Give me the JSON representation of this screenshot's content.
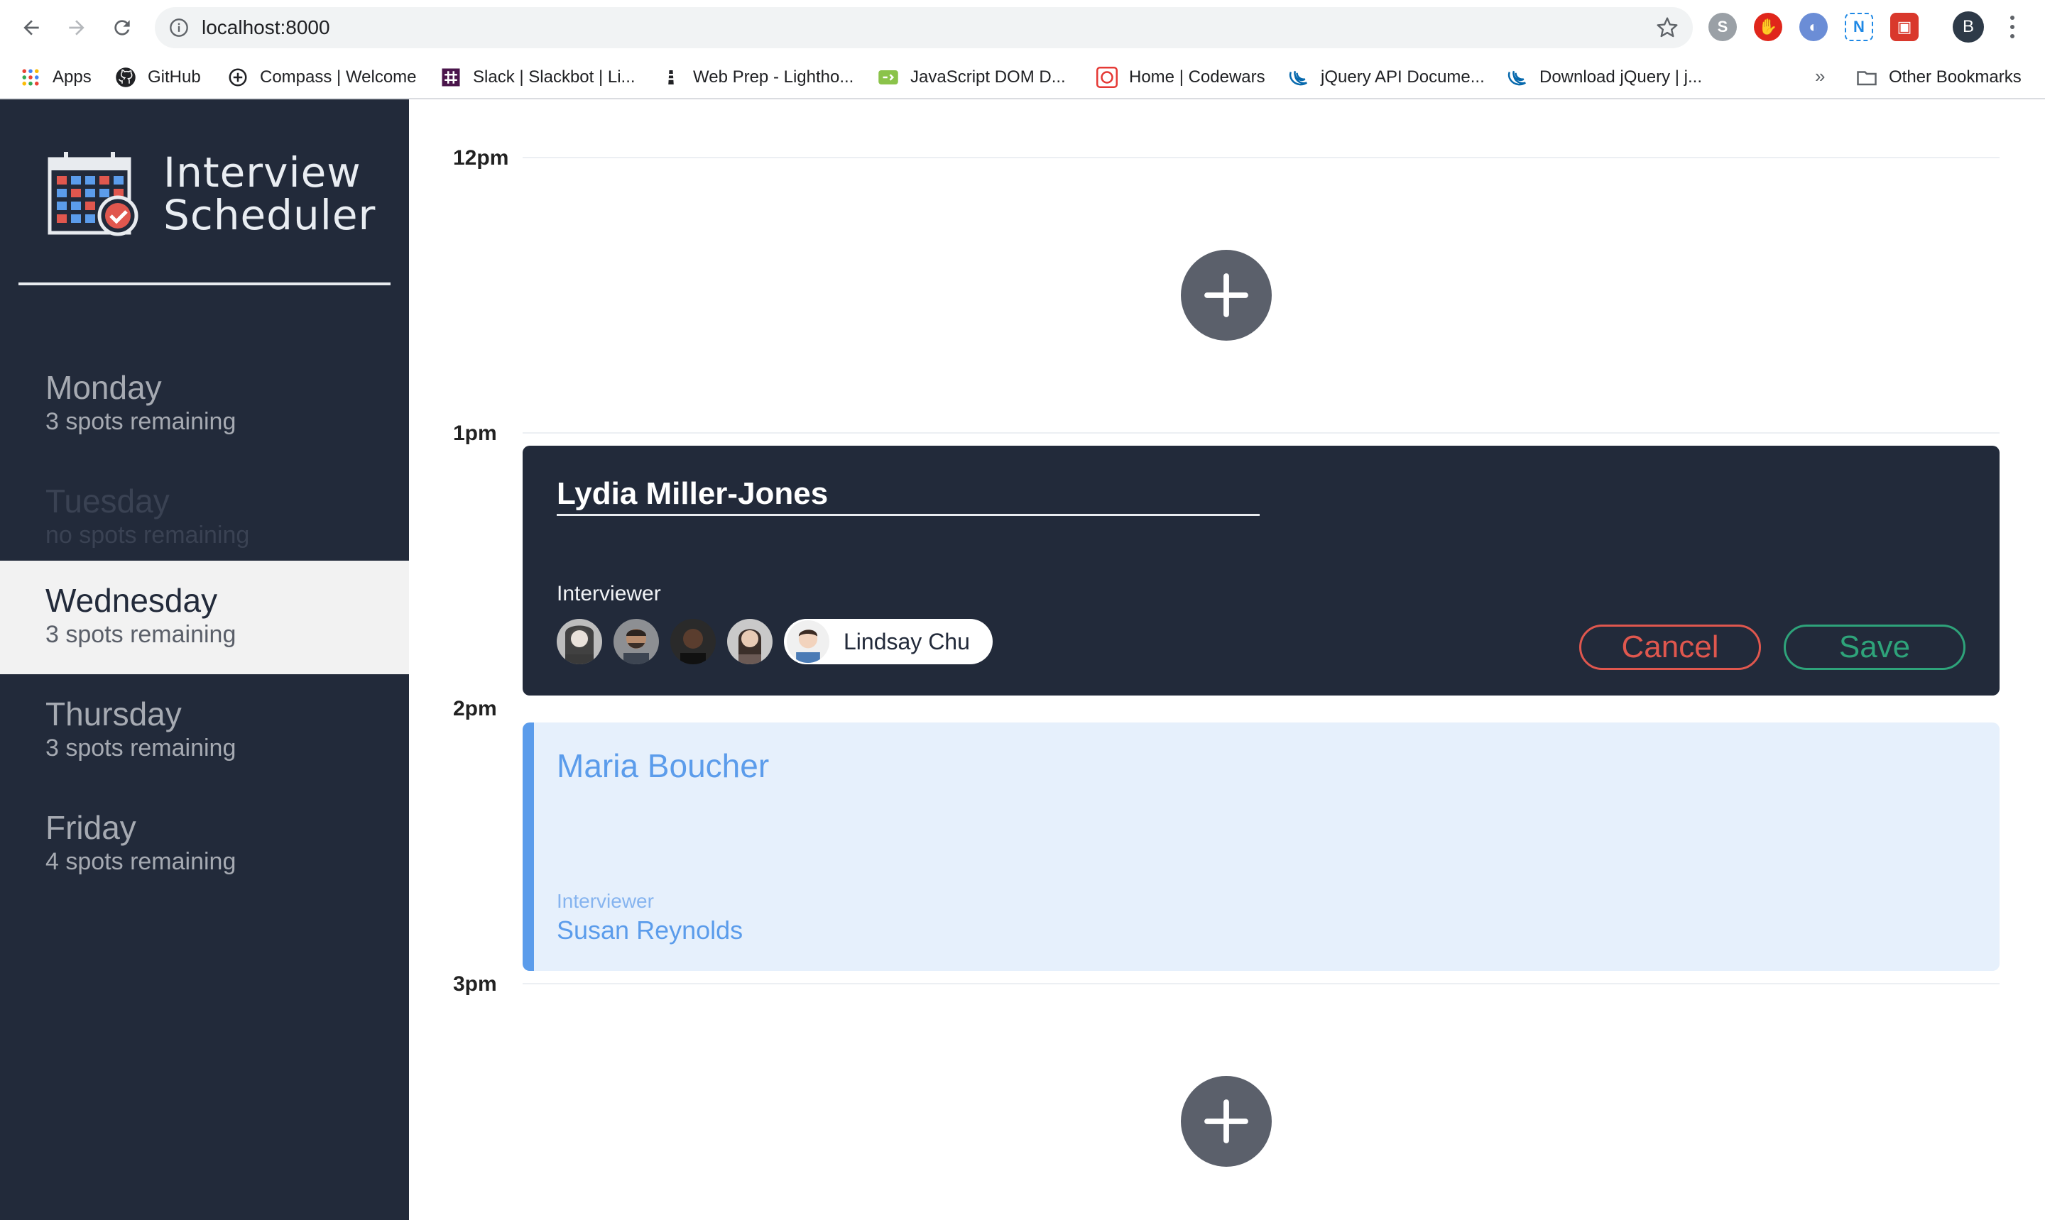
{
  "browser": {
    "url": "localhost:8000",
    "profile_initial": "B",
    "bookmarks": [
      {
        "label": "Apps",
        "icon": "apps-grid-icon"
      },
      {
        "label": "GitHub",
        "icon": "github-icon"
      },
      {
        "label": "Compass | Welcome",
        "icon": "compass-icon"
      },
      {
        "label": "Slack | Slackbot | Li...",
        "icon": "slack-icon"
      },
      {
        "label": "Web Prep - Lightho...",
        "icon": "lighthouse-icon"
      },
      {
        "label": "JavaScript DOM D...",
        "icon": "javascript-dom-icon"
      },
      {
        "label": "Home | Codewars",
        "icon": "codewars-icon"
      },
      {
        "label": "jQuery API Docume...",
        "icon": "jquery-icon"
      },
      {
        "label": "Download jQuery | j...",
        "icon": "jquery-icon"
      }
    ],
    "more_bookmarks": "»",
    "other_bookmarks": "Other Bookmarks"
  },
  "app": {
    "brand_line1": "Interview",
    "brand_line2": "Scheduler",
    "days": [
      {
        "name": "Monday",
        "spots": "3 spots remaining",
        "state": "normal"
      },
      {
        "name": "Tuesday",
        "spots": "no spots remaining",
        "state": "full"
      },
      {
        "name": "Wednesday",
        "spots": "3 spots remaining",
        "state": "selected"
      },
      {
        "name": "Thursday",
        "spots": "3 spots remaining",
        "state": "normal"
      },
      {
        "name": "Friday",
        "spots": "4 spots remaining",
        "state": "normal"
      }
    ]
  },
  "schedule": {
    "times": [
      "12pm",
      "1pm",
      "2pm",
      "3pm"
    ],
    "form": {
      "student_name": "Lydia Miller-Jones",
      "interviewer_label": "Interviewer",
      "selected_interviewer": "Lindsay Chu",
      "cancel_label": "Cancel",
      "save_label": "Save"
    },
    "show": {
      "student_name": "Maria Boucher",
      "interviewer_label": "Interviewer",
      "interviewer_name": "Susan Reynolds"
    }
  },
  "colors": {
    "sidebar_bg": "#222a3a",
    "selected_day_bg": "#f2f2f2",
    "cancel": "#e0574e",
    "save": "#2ea37a",
    "show_accent": "#5b9ceb",
    "show_bg": "#e6f0fc",
    "add_button": "#5b606b"
  }
}
